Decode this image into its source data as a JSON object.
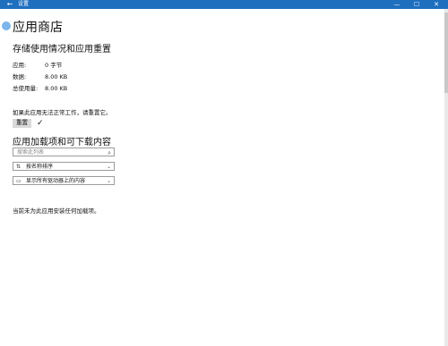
{
  "window": {
    "title": "设置",
    "back_glyph": "←",
    "minimize_glyph": "—",
    "maximize_glyph": "☐",
    "close_glyph": "✕"
  },
  "app": {
    "title": "应用商店"
  },
  "usage": {
    "section_title": "存储使用情况和应用重置",
    "rows": [
      {
        "label": "应用:",
        "value": "0 字节"
      },
      {
        "label": "数据:",
        "value": "8.00 KB"
      },
      {
        "label": "总使用量:",
        "value": "8.00 KB"
      }
    ],
    "hint": "如果此应用无法正常工作，请重置它。",
    "reset_label": "重置",
    "reset_done_glyph": "✓"
  },
  "addons": {
    "title": "应用加载项和可下载内容",
    "search_placeholder": "搜索此列表",
    "sort_label": "按名称排序",
    "filter_label": "显示所有驱动器上的内容",
    "empty_message": "当前未为此应用安装任何加载项。"
  },
  "colors": {
    "titlebar": "#1f6fbf",
    "button": "#d9d9d9"
  },
  "icons": {
    "search": "search-icon",
    "sort": "sort-icon",
    "drive": "drive-icon",
    "dropdown": "chevron-down-icon"
  }
}
